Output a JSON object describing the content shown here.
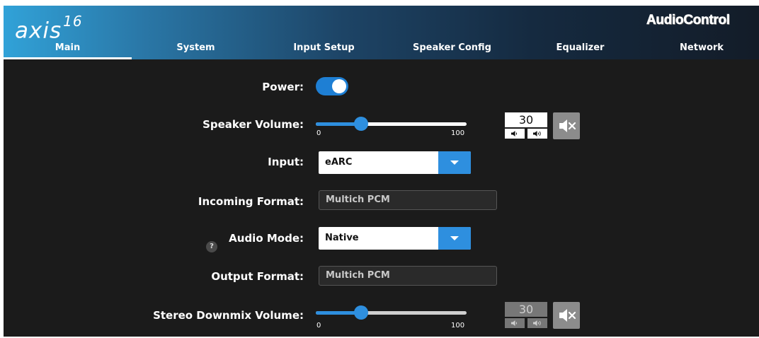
{
  "header": {
    "logo_text": "axis",
    "logo_superscript": "16",
    "brand": "AudioControl"
  },
  "tabs": [
    {
      "label": "Main",
      "active": true
    },
    {
      "label": "System"
    },
    {
      "label": "Input Setup"
    },
    {
      "label": "Speaker Config"
    },
    {
      "label": "Equalizer"
    },
    {
      "label": "Network"
    }
  ],
  "main": {
    "power": {
      "label": "Power:",
      "on": true
    },
    "speaker_volume": {
      "label": "Speaker Volume:",
      "value": "30",
      "min": "0",
      "max": "100",
      "fraction": 0.3
    },
    "input": {
      "label": "Input:",
      "value": "eARC"
    },
    "incoming_format": {
      "label": "Incoming Format:",
      "value": "Multich PCM"
    },
    "audio_mode": {
      "label": "Audio Mode:",
      "value": "Native",
      "help": "?"
    },
    "output_format": {
      "label": "Output Format:",
      "value": "Multich PCM"
    },
    "stereo_downmix_volume": {
      "label": "Stereo Downmix Volume:",
      "value": "30",
      "min": "0",
      "max": "100",
      "fraction": 0.3,
      "enabled": false
    }
  },
  "colors": {
    "accent": "#2e8fdf",
    "background": "#1b1b1b"
  }
}
